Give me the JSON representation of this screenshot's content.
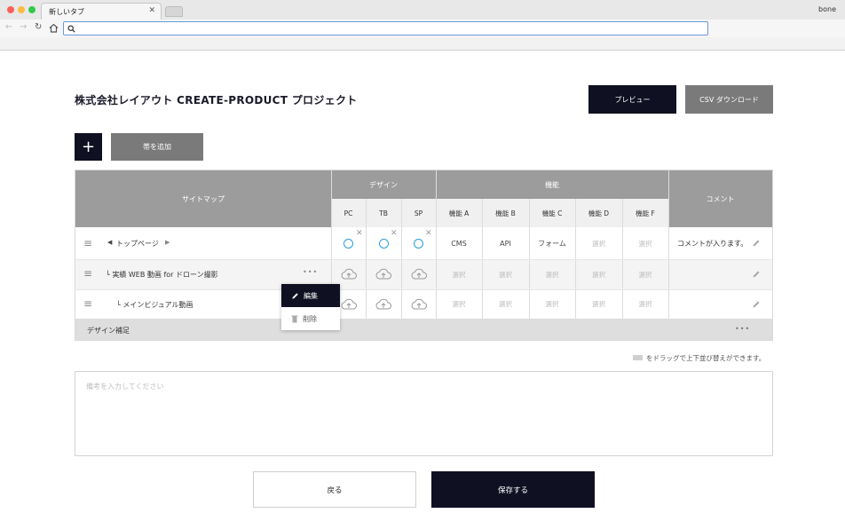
{
  "browser": {
    "tab_title": "新しいタブ",
    "tab_close": "✕",
    "profile_name": "bone",
    "url": "",
    "colors": {
      "close": "#fc605c",
      "minimize": "#fdbc40",
      "zoom": "#34c84a"
    }
  },
  "header": {
    "title": "株式会社レイアウト CREATE-PRODUCT プロジェクト",
    "preview_label": "プレビュー",
    "csv_label": "CSV ダウンロード"
  },
  "actions": {
    "add_icon": "+",
    "add_band_label": "帯を追加"
  },
  "table": {
    "sitemap_header": "サイトマップ",
    "design_header": "デザイン",
    "function_header": "機能",
    "comment_header": "コメント",
    "design_cols": [
      "PC",
      "TB",
      "SP"
    ],
    "function_cols": [
      "機能 A",
      "機能 B",
      "機能 C",
      "機能 D",
      "機能 F"
    ],
    "rows": [
      {
        "label": "トップページ",
        "functions": [
          "CMS",
          "API",
          "フォーム",
          "選択",
          "選択"
        ],
        "comment": "コメントが入ります。"
      },
      {
        "label": "└ 実績 WEB 動画 for ドローン撮影",
        "functions": [
          "選択",
          "選択",
          "選択",
          "選択",
          "選択"
        ],
        "comment": ""
      },
      {
        "label": "└ メインビジュアル動画",
        "functions": [
          "選択",
          "選択",
          "選択",
          "選択",
          "選択"
        ],
        "comment": ""
      }
    ],
    "band_label": "デザイン補足",
    "more_dots": "•••"
  },
  "context_menu": {
    "edit_label": "編集",
    "delete_label": "削除"
  },
  "drag_hint": "をドラッグで上下並び替えができます。",
  "notes": {
    "placeholder": "備考を入力してください"
  },
  "footer": {
    "back_label": "戻る",
    "save_label": "保存する"
  },
  "colors": {
    "primary": "#0f1021",
    "header_grey": "#9c9c9c",
    "check_blue": "#2a9fd6"
  }
}
